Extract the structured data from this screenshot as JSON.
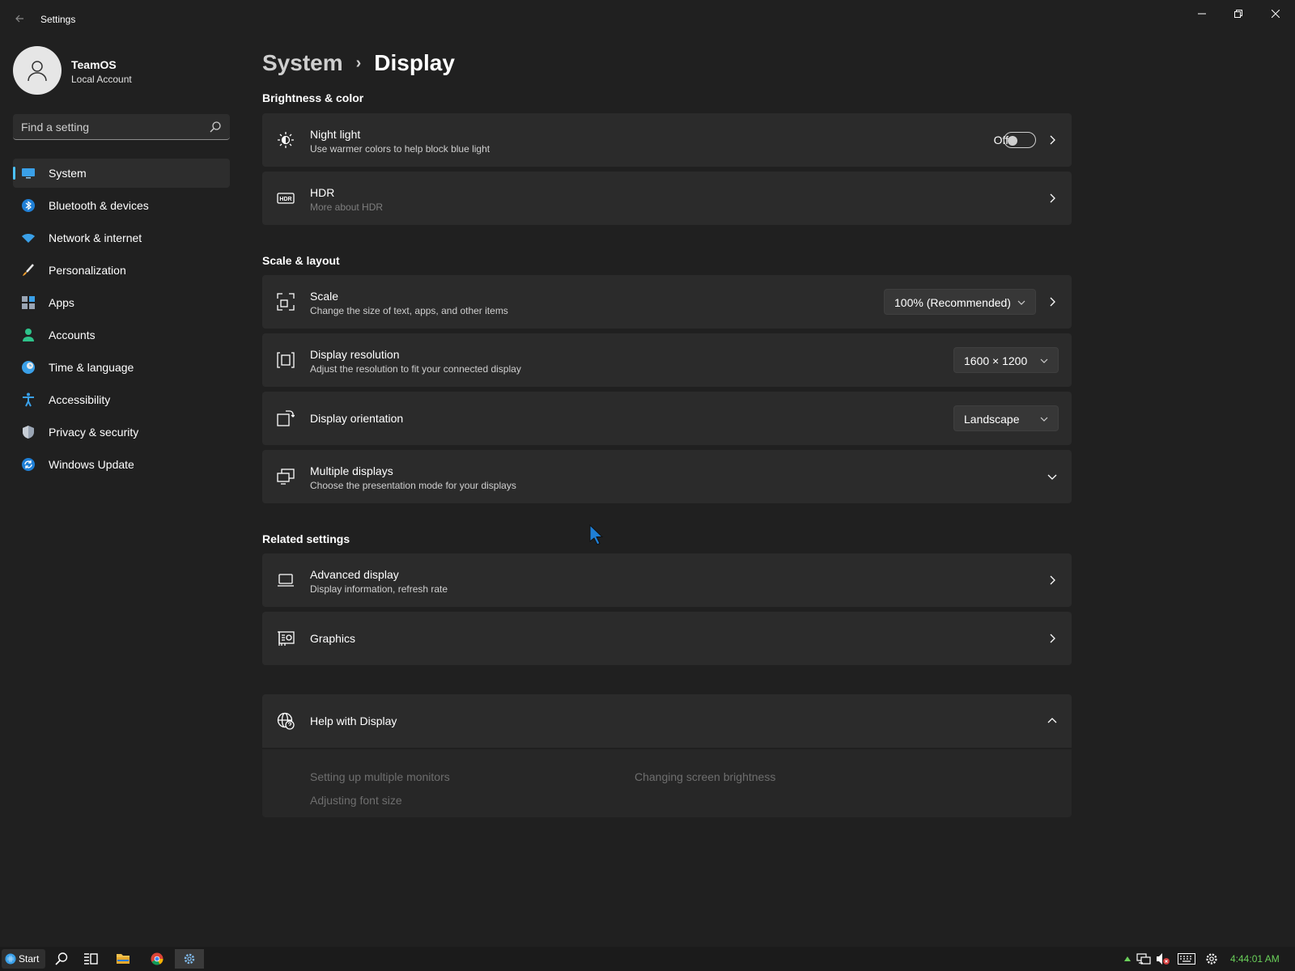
{
  "window": {
    "title": "Settings"
  },
  "user": {
    "name": "TeamOS",
    "account_type": "Local Account"
  },
  "search": {
    "placeholder": "Find a setting"
  },
  "nav": {
    "items": [
      {
        "label": "System",
        "icon": "monitor-icon",
        "active": true
      },
      {
        "label": "Bluetooth & devices",
        "icon": "bluetooth-icon"
      },
      {
        "label": "Network & internet",
        "icon": "wifi-icon"
      },
      {
        "label": "Personalization",
        "icon": "brush-icon"
      },
      {
        "label": "Apps",
        "icon": "apps-icon"
      },
      {
        "label": "Accounts",
        "icon": "person-icon"
      },
      {
        "label": "Time & language",
        "icon": "globe-clock-icon"
      },
      {
        "label": "Accessibility",
        "icon": "accessibility-icon"
      },
      {
        "label": "Privacy & security",
        "icon": "shield-icon"
      },
      {
        "label": "Windows Update",
        "icon": "update-icon"
      }
    ]
  },
  "breadcrumb": {
    "parent": "System",
    "separator": "›",
    "current": "Display"
  },
  "sections": {
    "brightness": {
      "title": "Brightness & color",
      "night_light": {
        "title": "Night light",
        "subtitle": "Use warmer colors to help block blue light",
        "toggle_label": "Off",
        "enabled": false
      },
      "hdr": {
        "title": "HDR",
        "subtitle": "More about HDR"
      }
    },
    "scale_layout": {
      "title": "Scale & layout",
      "scale": {
        "title": "Scale",
        "subtitle": "Change the size of text, apps, and other items",
        "value": "100% (Recommended)"
      },
      "resolution": {
        "title": "Display resolution",
        "subtitle": "Adjust the resolution to fit your connected display",
        "value": "1600 × 1200"
      },
      "orientation": {
        "title": "Display orientation",
        "value": "Landscape"
      },
      "multiple": {
        "title": "Multiple displays",
        "subtitle": "Choose the presentation mode for your displays"
      }
    },
    "related": {
      "title": "Related settings",
      "advanced": {
        "title": "Advanced display",
        "subtitle": "Display information, refresh rate"
      },
      "graphics": {
        "title": "Graphics"
      }
    },
    "help": {
      "title": "Help with Display",
      "links": [
        "Setting up multiple monitors",
        "Changing screen brightness",
        "Adjusting font size"
      ]
    }
  },
  "taskbar": {
    "start_label": "Start",
    "clock": "4:44:01 AM"
  },
  "colors": {
    "background": "#202020",
    "card": "#2b2b2b",
    "accent": "#4cc2ff",
    "clock": "#6ad05a"
  }
}
